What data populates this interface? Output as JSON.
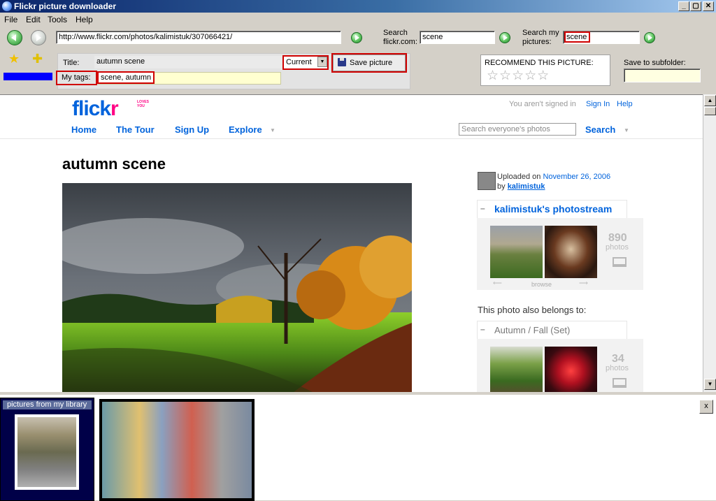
{
  "window": {
    "title": "Flickr picture downloader"
  },
  "menu": [
    "File",
    "Edit",
    "Tools",
    "Help"
  ],
  "toolbar": {
    "url": "http://www.flickr.com/photos/kalimistuk/307066421/",
    "search_flickr_label_1": "Search",
    "search_flickr_label_2": "flickr.com:",
    "search_flickr_value": "scene",
    "search_my_label_1": "Search my",
    "search_my_label_2": "pictures:",
    "search_my_value": "scene"
  },
  "tags_panel": {
    "title_label": "Title:",
    "title_value": "autumn scene",
    "tags_label": "My tags:",
    "tags_value": "scene, autumn",
    "dropdown_value": "Current",
    "save_button": "Save picture"
  },
  "recommend": {
    "label": "RECOMMEND THIS PICTURE:",
    "stars": "☆☆☆☆☆"
  },
  "subfolder": {
    "label": "Save to subfolder:",
    "value": ""
  },
  "flickr": {
    "logo_1": "flick",
    "logo_2": "r",
    "logo_tm": "LOVES YOU",
    "not_signed": "You aren't signed in",
    "sign_in": "Sign In",
    "help": "Help",
    "nav": [
      "Home",
      "The Tour",
      "Sign Up",
      "Explore"
    ],
    "search_placeholder": "Search everyone's photos",
    "search_button": "Search",
    "photo_title": "autumn scene",
    "uploaded_label": "Uploaded on",
    "uploaded_date": "November 26, 2006",
    "by_label": "by",
    "by_user": "kalimistuk",
    "photostream_title": "kalimistuk's photostream",
    "photostream_count": "890",
    "photos_word": "photos",
    "browse_label": "browse",
    "belongs_label": "This photo also belongs to:",
    "set_title": "Autumn / Fall (Set)",
    "set_count": "34"
  },
  "library": {
    "label": "pictures from my library",
    "close": "x"
  },
  "colors": {
    "flickr_blue": "#0063dc",
    "flickr_pink": "#ff0084",
    "highlight_red": "#d00000",
    "progress_blue": "#0000ff"
  }
}
